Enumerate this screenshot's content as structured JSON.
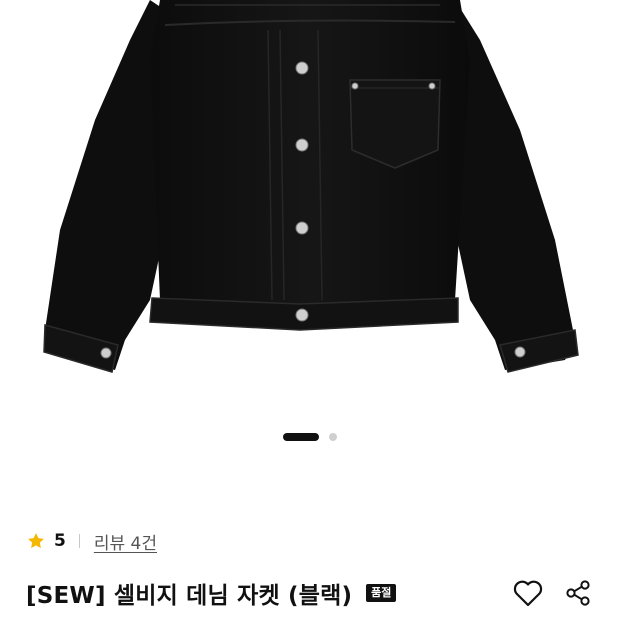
{
  "product": {
    "image_alt": "black denim jacket",
    "pager": {
      "total": 2,
      "active": 1
    },
    "rating": {
      "icon": "star-icon",
      "color": "#f5b800",
      "value": "5"
    },
    "review_link": "리뷰 4건",
    "title": "[SEW] 셀비지 데님 자켓 (블랙)",
    "badge": "품절",
    "actions": {
      "like_icon": "heart-icon",
      "share_icon": "share-icon"
    }
  }
}
